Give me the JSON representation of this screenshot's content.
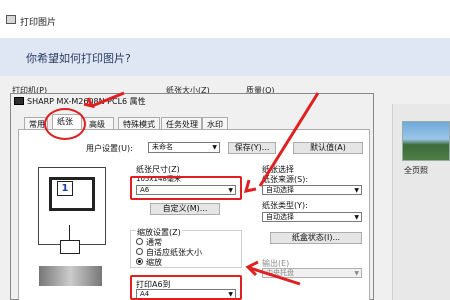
{
  "window": {
    "title": "打印图片",
    "prompt": "你希望如何打印图片?"
  },
  "behind_labels": [
    "打印机(P)",
    "纸张大小(Z)",
    "质量(Q)"
  ],
  "dialog": {
    "title": "SHARP MX-M2608N PCL6 属性",
    "tabs": [
      "常用",
      "纸张",
      "高级",
      "特殊模式",
      "任务处理",
      "水印"
    ],
    "active_tab": "纸张",
    "user_settings_label": "用户设置(U):",
    "user_settings_value": "未命名",
    "save_button": "保存(Y)...",
    "default_button": "默认值(A)",
    "paper_size_label": "纸张尺寸(Z)",
    "paper_size_sub": "105x148毫米",
    "paper_size_value": "A6",
    "custom_button": "自定义(M)...",
    "zoom_group_label": "缩放设置(Z)",
    "zoom_options": [
      "通常",
      "自适应纸张大小",
      "缩放"
    ],
    "zoom_selected": 2,
    "print_to_label": "打印A6到",
    "print_to_value": "A4",
    "paper_select_label": "纸张选择",
    "source_label": "纸张来源(S):",
    "source_value": "自动选择",
    "type_label": "纸张类型(Y):",
    "type_value": "自动选择",
    "tray_status_button": "纸盒状态(I)...",
    "output_label": "输出(E)",
    "output_value": "中央托盘"
  },
  "thumbnail_label": "全页照",
  "preview_page_number": "1"
}
